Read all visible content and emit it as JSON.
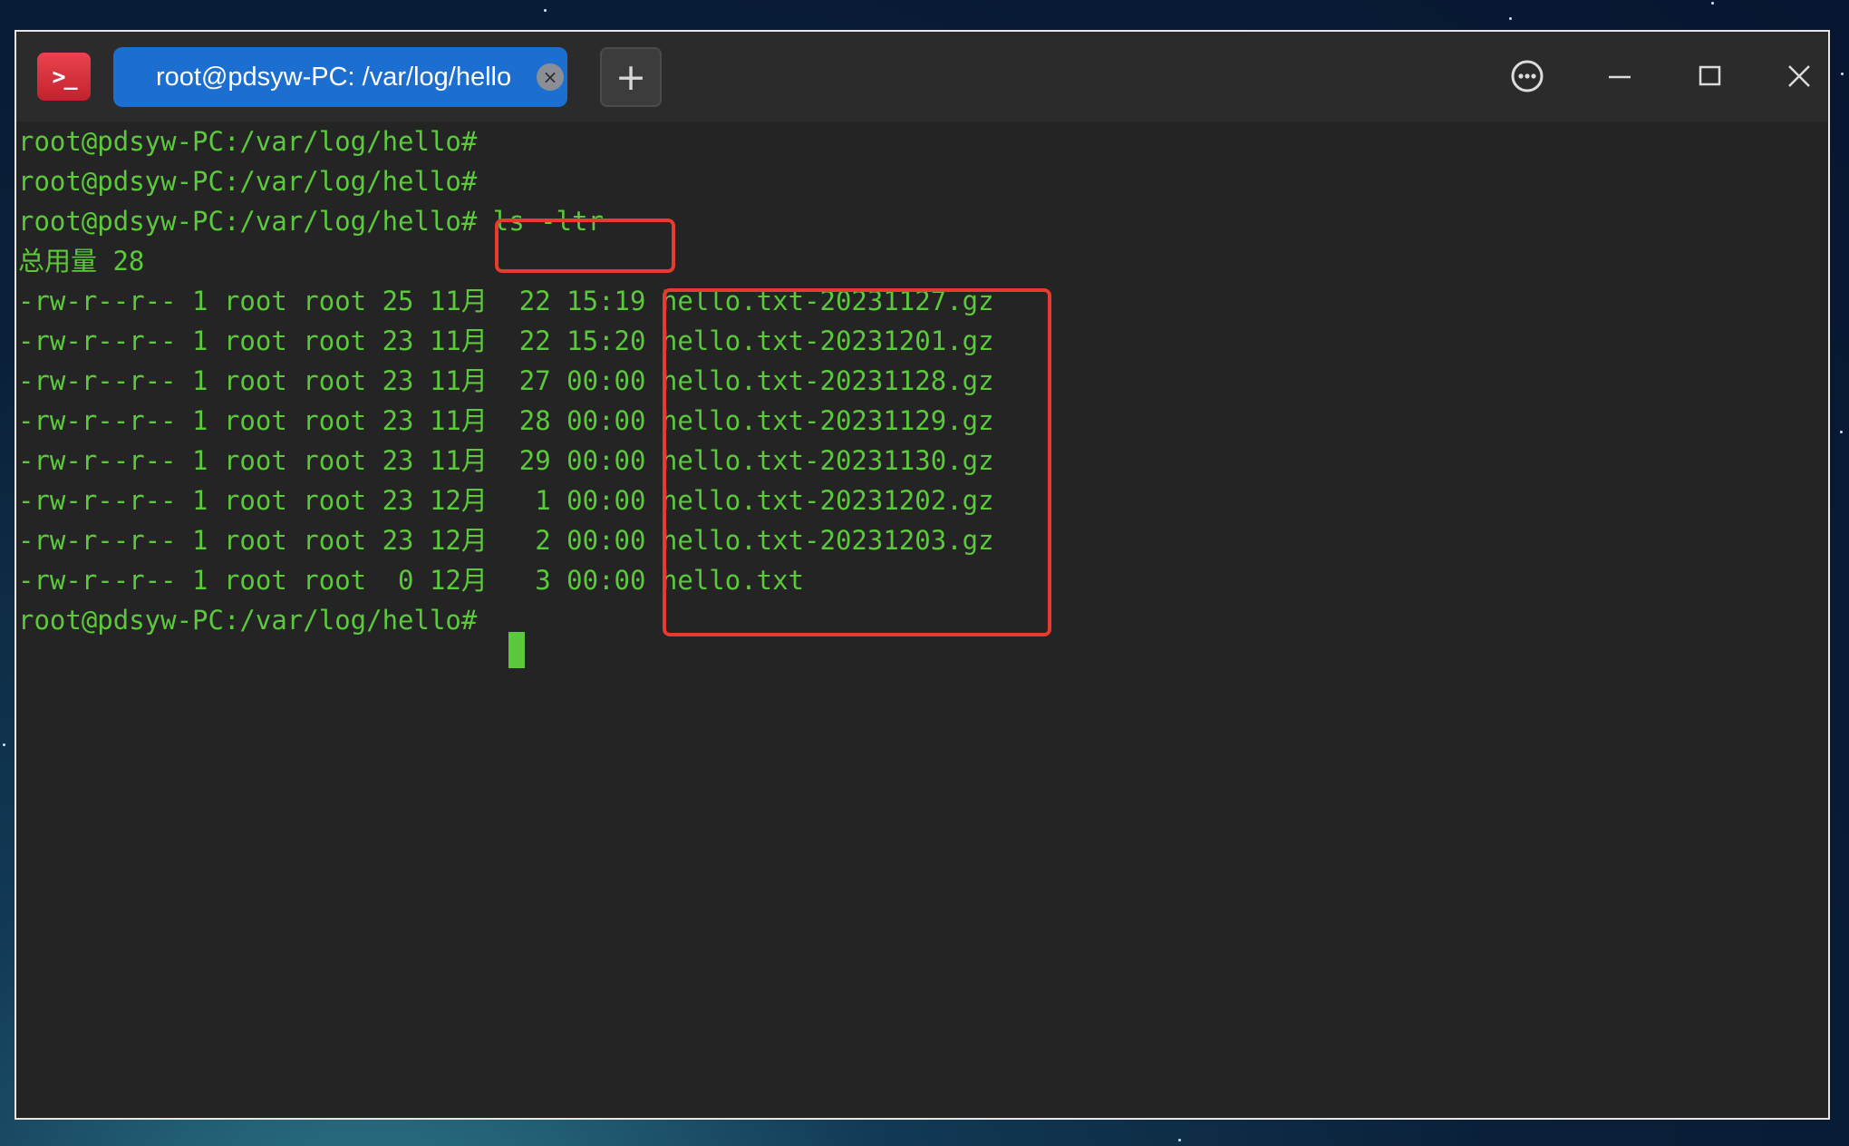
{
  "window": {
    "app_icon_glyph": ">_",
    "tab_title": "root@pdsyw-PC: /var/log/hello",
    "tab_close_glyph": "×",
    "new_tab_glyph": "+"
  },
  "terminal": {
    "lines": [
      "root@pdsyw-PC:/var/log/hello#",
      "root@pdsyw-PC:/var/log/hello#",
      "root@pdsyw-PC:/var/log/hello# ls -ltr",
      "总用量 28",
      "-rw-r--r-- 1 root root 25 11月  22 15:19 hello.txt-20231127.gz",
      "-rw-r--r-- 1 root root 23 11月  22 15:20 hello.txt-20231201.gz",
      "-rw-r--r-- 1 root root 23 11月  27 00:00 hello.txt-20231128.gz",
      "-rw-r--r-- 1 root root 23 11月  28 00:00 hello.txt-20231129.gz",
      "-rw-r--r-- 1 root root 23 11月  29 00:00 hello.txt-20231130.gz",
      "-rw-r--r-- 1 root root 23 12月   1 00:00 hello.txt-20231202.gz",
      "-rw-r--r-- 1 root root 23 12月   2 00:00 hello.txt-20231203.gz",
      "-rw-r--r-- 1 root root  0 12月   3 00:00 hello.txt",
      "root@pdsyw-PC:/var/log/hello#"
    ],
    "text_color": "#5cc83b"
  },
  "colors": {
    "tab_active": "#1c6fd0",
    "highlight_box": "#e63b2e",
    "terminal_background": "#242424"
  },
  "icons": {
    "app": "terminal-app-icon",
    "tab_close": "close-tab-icon",
    "new_tab": "plus-icon",
    "menu": "more-options-icon",
    "minimize": "minimize-icon",
    "maximize": "maximize-icon",
    "close": "close-icon"
  }
}
